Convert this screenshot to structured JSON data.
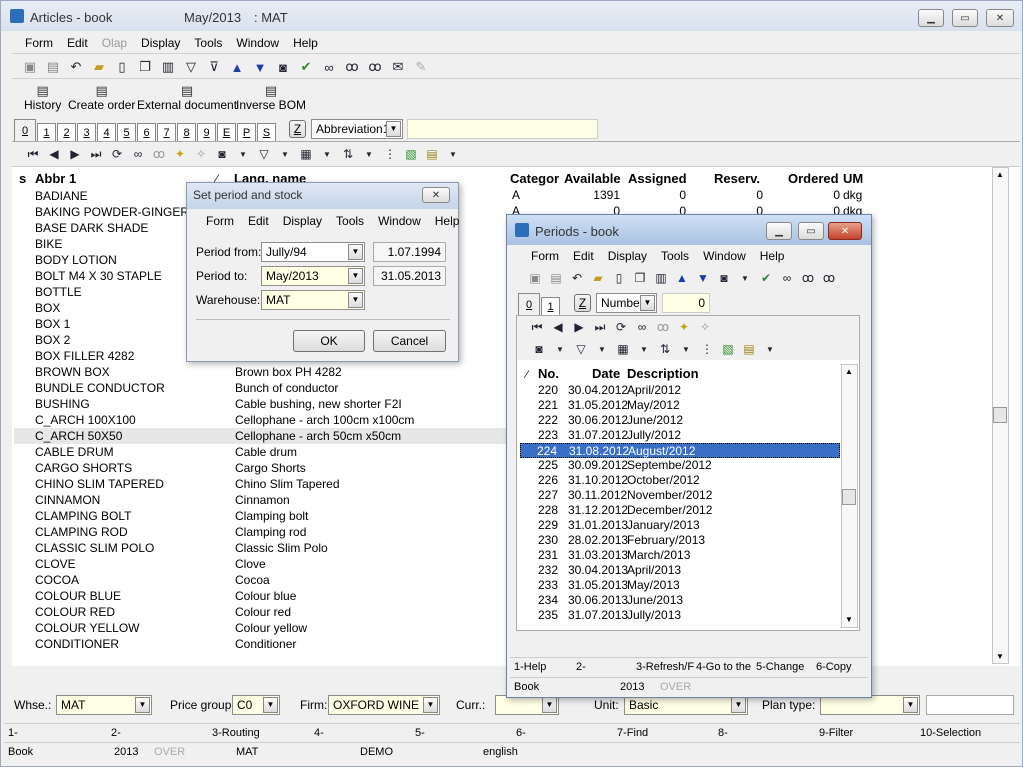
{
  "main": {
    "title": "Articles - book",
    "period": "May/2013",
    "warehouse_title": ": MAT",
    "menu": [
      "Form",
      "Edit",
      "Olap",
      "Display",
      "Tools",
      "Window",
      "Help"
    ],
    "captions": [
      "History",
      "Create order",
      "External document",
      "Inverse BOM"
    ],
    "tabs": [
      "0",
      "1",
      "2",
      "3",
      "4",
      "5",
      "6",
      "7",
      "8",
      "9",
      "E",
      "P",
      "S"
    ],
    "z_label": "Z",
    "sort_select": "Abbreviation1",
    "columns": [
      "s",
      "Abbr 1",
      "Lang. name",
      "Categor",
      "Available",
      "Assigned",
      "Reserv.",
      "Ordered",
      "UM"
    ],
    "first_row_values": {
      "cat": "A",
      "avail": "1391",
      "assigned": "0",
      "reserv": "0",
      "ordered": "0",
      "um": "dkg"
    },
    "second_row_values": {
      "cat": "A",
      "avail": "0",
      "assigned": "0",
      "reserv": "0",
      "ordered": "0",
      "um": "dkg"
    },
    "rows": [
      {
        "abbr": "BADIANE",
        "name": ""
      },
      {
        "abbr": "BAKING POWDER-GINGER",
        "name": ""
      },
      {
        "abbr": "BASE DARK SHADE",
        "name": ""
      },
      {
        "abbr": "BIKE",
        "name": ""
      },
      {
        "abbr": "BODY LOTION",
        "name": ""
      },
      {
        "abbr": "BOLT M4 X 30 STAPLE",
        "name": ""
      },
      {
        "abbr": "BOTTLE",
        "name": ""
      },
      {
        "abbr": "BOX",
        "name": ""
      },
      {
        "abbr": "BOX 1",
        "name": ""
      },
      {
        "abbr": "BOX 2",
        "name": ""
      },
      {
        "abbr": "BOX FILLER 4282",
        "name": ""
      },
      {
        "abbr": "BROWN BOX",
        "name": "Brown box PH 4282"
      },
      {
        "abbr": "BUNDLE CONDUCTOR",
        "name": "Bunch of conductor"
      },
      {
        "abbr": "BUSHING",
        "name": "Cable bushing, new shorter F2I"
      },
      {
        "abbr": "C_ARCH 100X100",
        "name": "Cellophane - arch 100cm x100cm"
      },
      {
        "abbr": "C_ARCH 50X50",
        "name": "Cellophane - arch 50cm x50cm"
      },
      {
        "abbr": "CABLE DRUM",
        "name": "Cable drum"
      },
      {
        "abbr": "CARGO SHORTS",
        "name": "Cargo Shorts"
      },
      {
        "abbr": "CHINO SLIM TAPERED",
        "name": "Chino Slim Tapered"
      },
      {
        "abbr": "CINNAMON",
        "name": "Cinnamon"
      },
      {
        "abbr": "CLAMPING BOLT",
        "name": "Clamping bolt"
      },
      {
        "abbr": "CLAMPING ROD",
        "name": "Clamping rod"
      },
      {
        "abbr": "CLASSIC SLIM POLO",
        "name": "Classic Slim Polo"
      },
      {
        "abbr": "CLOVE",
        "name": "Clove"
      },
      {
        "abbr": "COCOA",
        "name": "Cocoa"
      },
      {
        "abbr": "COLOUR BLUE",
        "name": "Colour blue"
      },
      {
        "abbr": "COLOUR RED",
        "name": "Colour red"
      },
      {
        "abbr": "COLOUR YELLOW",
        "name": "Colour yellow"
      },
      {
        "abbr": "CONDITIONER",
        "name": "Conditioner"
      }
    ],
    "selected_row_index": 15,
    "filters": {
      "whse_label": "Whse.:",
      "whse_value": "MAT",
      "price_label": "Price group:",
      "price_value": "C0",
      "firm_label": "Firm:",
      "firm_value": "OXFORD WINE",
      "curr_label": "Curr.:",
      "curr_value": "",
      "unit_label": "Unit:",
      "unit_value": "Basic",
      "plan_label": "Plan type:",
      "plan_value": ""
    },
    "fkeys": [
      "1-",
      "2-",
      "3-Routing",
      "4-",
      "5-",
      "6-",
      "7-Find",
      "8-",
      "9-Filter",
      "10-Selection"
    ],
    "status": {
      "book": "Book",
      "year": "2013",
      "over": "OVER",
      "whse": "MAT",
      "user": "DEMO",
      "lang": "english"
    }
  },
  "dialog_period": {
    "title": "Set period and stock",
    "menu": [
      "Form",
      "Edit",
      "Display",
      "Tools",
      "Window",
      "Help"
    ],
    "from_label": "Period from:",
    "from_value": "Jully/94",
    "from_date": "1.07.1994",
    "to_label": "Period to:",
    "to_value": "May/2013",
    "to_date": "31.05.2013",
    "wh_label": "Warehouse:",
    "wh_value": "MAT",
    "ok": "OK",
    "cancel": "Cancel"
  },
  "periods": {
    "title": "Periods - book",
    "menu": [
      "Form",
      "Edit",
      "Display",
      "Tools",
      "Window",
      "Help"
    ],
    "tabs": [
      "0",
      "1"
    ],
    "z_label": "Z",
    "sort_select": "Number",
    "search_value": "0",
    "columns": [
      "No.",
      "Date",
      "Description"
    ],
    "rows": [
      {
        "no": "220",
        "date": "30.04.2012",
        "desc": "April/2012"
      },
      {
        "no": "221",
        "date": "31.05.2012",
        "desc": "May/2012"
      },
      {
        "no": "222",
        "date": "30.06.2012",
        "desc": "June/2012"
      },
      {
        "no": "223",
        "date": "31.07.2012",
        "desc": "Jully/2012"
      },
      {
        "no": "224",
        "date": "31.08.2012",
        "desc": "August/2012"
      },
      {
        "no": "225",
        "date": "30.09.2012",
        "desc": "Septembe/2012"
      },
      {
        "no": "226",
        "date": "31.10.2012",
        "desc": "October/2012"
      },
      {
        "no": "227",
        "date": "30.11.2012",
        "desc": "November/2012"
      },
      {
        "no": "228",
        "date": "31.12.2012",
        "desc": "December/2012"
      },
      {
        "no": "229",
        "date": "31.01.2013",
        "desc": "January/2013"
      },
      {
        "no": "230",
        "date": "28.02.2013",
        "desc": "February/2013"
      },
      {
        "no": "231",
        "date": "31.03.2013",
        "desc": "March/2013"
      },
      {
        "no": "232",
        "date": "30.04.2013",
        "desc": "April/2013"
      },
      {
        "no": "233",
        "date": "31.05.2013",
        "desc": "May/2013"
      },
      {
        "no": "234",
        "date": "30.06.2013",
        "desc": "June/2013"
      },
      {
        "no": "235",
        "date": "31.07.2013",
        "desc": "Jully/2013"
      }
    ],
    "selected_row_index": 4,
    "fkeys": [
      "1-Help",
      "2-",
      "3-Refresh/F",
      "4-Go to the",
      "5-Change",
      "6-Copy"
    ],
    "status": {
      "book": "Book",
      "year": "2013",
      "over": "OVER"
    }
  },
  "colors": {
    "accent": "#3a6fc8",
    "field_yellow": "#ffffe6",
    "title_bar": "#c6d4e8"
  }
}
